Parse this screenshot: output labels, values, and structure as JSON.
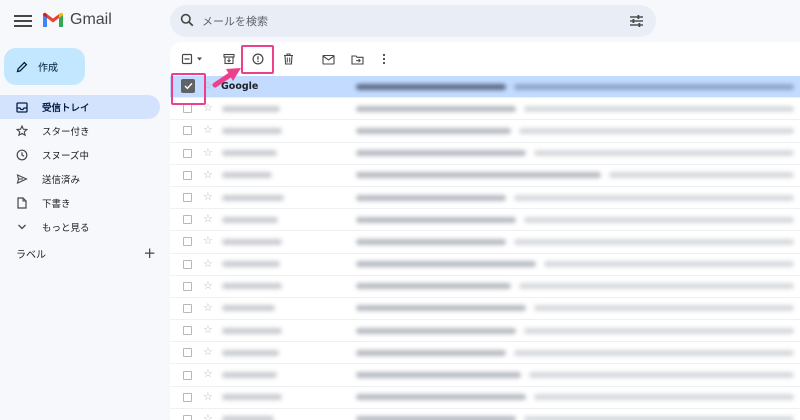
{
  "app": {
    "logo_text": "Gmail"
  },
  "search": {
    "placeholder": "メールを検索"
  },
  "compose": {
    "label": "作成"
  },
  "nav": [
    {
      "label": "受信トレイ",
      "icon": "inbox-icon",
      "active": true
    },
    {
      "label": "スター付き",
      "icon": "star-icon"
    },
    {
      "label": "スヌーズ中",
      "icon": "clock-icon"
    },
    {
      "label": "送信済み",
      "icon": "send-icon"
    },
    {
      "label": "下書き",
      "icon": "draft-icon"
    },
    {
      "label": "もっと見る",
      "icon": "chevron-down-icon"
    }
  ],
  "labels": {
    "title": "ラベル"
  },
  "toolbar": [
    "select-dropdown",
    "archive-icon",
    "report-spam-icon",
    "delete-icon",
    "mark-as-read-icon",
    "move-to-icon",
    "more-options-icon"
  ],
  "messages": [
    {
      "sender": "Google",
      "selected": true
    }
  ],
  "colors": {
    "accent": "#c2e7ff",
    "active_nav": "#d3e3fd",
    "selected_row": "#c2dbff",
    "highlight": "#ec3f8c"
  }
}
